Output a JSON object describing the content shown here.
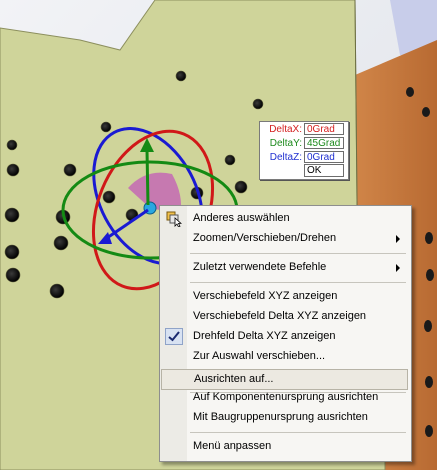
{
  "delta_dialog": {
    "rows": [
      {
        "label": "DeltaX:",
        "value": "0Grad",
        "label_color": "#d42020",
        "value_color": "#d42020"
      },
      {
        "label": "DeltaY:",
        "value": "45Grad",
        "label_color": "#1c8a1c",
        "value_color": "#1c8a1c"
      },
      {
        "label": "DeltaZ:",
        "value": "0Grad",
        "label_color": "#2030d0",
        "value_color": "#2030d0"
      }
    ],
    "ok_label": "OK"
  },
  "context_menu": {
    "items": [
      {
        "label": "Anderes auswählen",
        "icon": "select-other-icon"
      },
      {
        "label": "Zoomen/Verschieben/Drehen",
        "submenu": true
      },
      {
        "label": "Zuletzt verwendete Befehle",
        "submenu": true
      },
      {
        "label": "Verschiebefeld XYZ anzeigen"
      },
      {
        "label": "Verschiebefeld Delta XYZ anzeigen"
      },
      {
        "label": "Drehfeld Delta XYZ anzeigen",
        "checked": true,
        "icon": "checkmark-icon"
      },
      {
        "label": "Zur Auswahl verschieben..."
      },
      {
        "label": "Ausrichten auf...",
        "highlighted": true
      },
      {
        "label": "Auf Komponentenursprung ausrichten"
      },
      {
        "label": "Mit Baugruppenursprung ausrichten"
      },
      {
        "label": "Menü anpassen"
      }
    ]
  },
  "colors": {
    "plate": "#cfd49a",
    "plate_side": "#c8783f",
    "background": "#eef0f4",
    "menu_background": "#f7f6f3",
    "ring_red": "#d01818",
    "ring_green": "#148a14",
    "ring_blue": "#1a1ad2"
  }
}
